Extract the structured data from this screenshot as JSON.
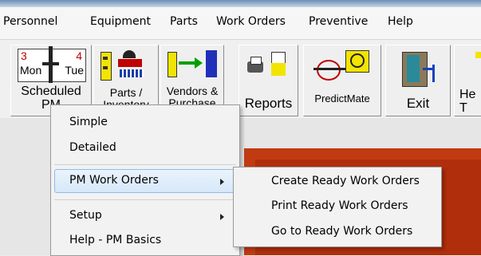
{
  "menubar": {
    "items": [
      "Personnel",
      "Equipment",
      "Parts",
      "Work Orders",
      "Preventive",
      "Help"
    ]
  },
  "toolbar": {
    "buttons": [
      {
        "label": "Scheduled PM",
        "icon": "calendar-icon",
        "cal_left": "3",
        "cal_right": "4",
        "cal_day1": "Mon",
        "cal_day2": "Tue"
      },
      {
        "label": "Parts / Inventory",
        "icon": "parts-inventory-icon"
      },
      {
        "label": "Vendors & Purchase",
        "icon": "vendor-arrow-icon"
      },
      {
        "label": "Reports",
        "icon": "printer-icon"
      },
      {
        "label": "PredictMate",
        "icon": "predictmate-icon"
      },
      {
        "label": "Exit",
        "icon": "exit-door-icon"
      },
      {
        "label": "He T",
        "icon": "help-icon"
      }
    ]
  },
  "context_menu": {
    "items": [
      {
        "label": "Simple",
        "has_submenu": false
      },
      {
        "label": "Detailed",
        "has_submenu": false
      },
      {
        "label": "PM Work Orders",
        "has_submenu": true,
        "highlighted": true
      },
      {
        "label": "Setup",
        "has_submenu": true
      },
      {
        "label": "Help - PM Basics",
        "has_submenu": false
      }
    ]
  },
  "submenu": {
    "items": [
      "Create Ready Work Orders",
      "Print Ready Work Orders",
      "Go to Ready Work Orders"
    ]
  },
  "colors": {
    "accent_red": "#c13a12",
    "highlight": "#d6e8fa",
    "highlight_border": "#8fbce8"
  }
}
